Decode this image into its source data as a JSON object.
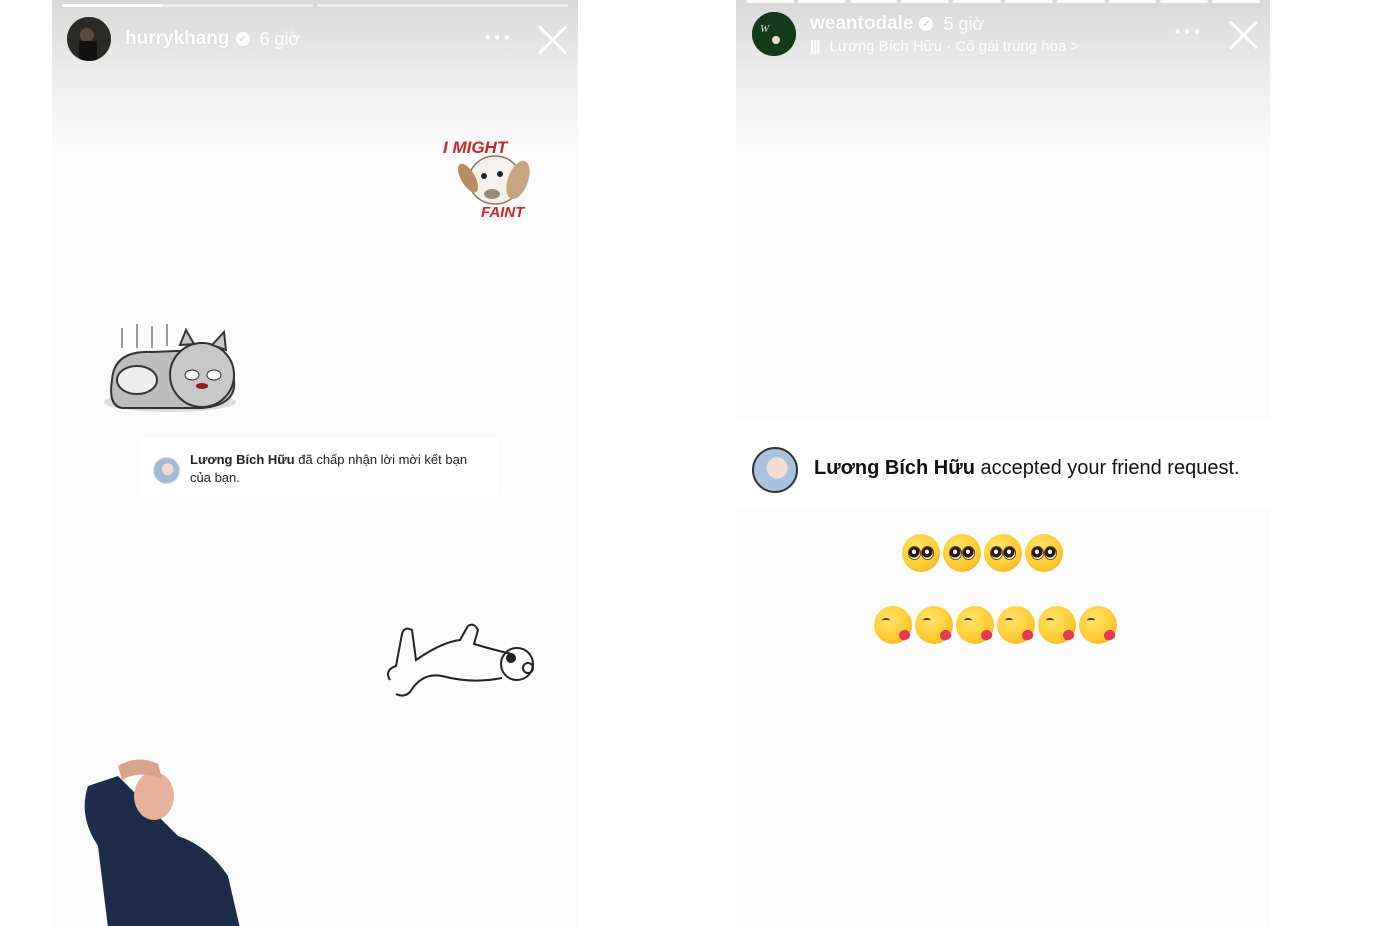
{
  "left_story": {
    "username": "hurrykhang",
    "time": "6 giờ",
    "more_label": "···",
    "progress": [
      0.33,
      0
    ],
    "sticker_might": "I MIGHT",
    "sticker_faint": "FAINT",
    "notification": {
      "name": "Lương Bích Hữu",
      "message": "đã chấp nhận lời mời kết bạn của bạn."
    }
  },
  "right_story": {
    "username": "weantodale",
    "time": "5 giờ",
    "more_label": "···",
    "music": "Lương Bích Hữu · Cô gái trung hoa >",
    "progress_count": 10,
    "notification": {
      "name": "Lương Bích Hữu",
      "message": "accepted your friend request."
    },
    "emoji_rows": [
      {
        "emoji": "pleading-face",
        "count": 4
      },
      {
        "emoji": "face-blowing-kiss",
        "count": 6
      }
    ]
  }
}
